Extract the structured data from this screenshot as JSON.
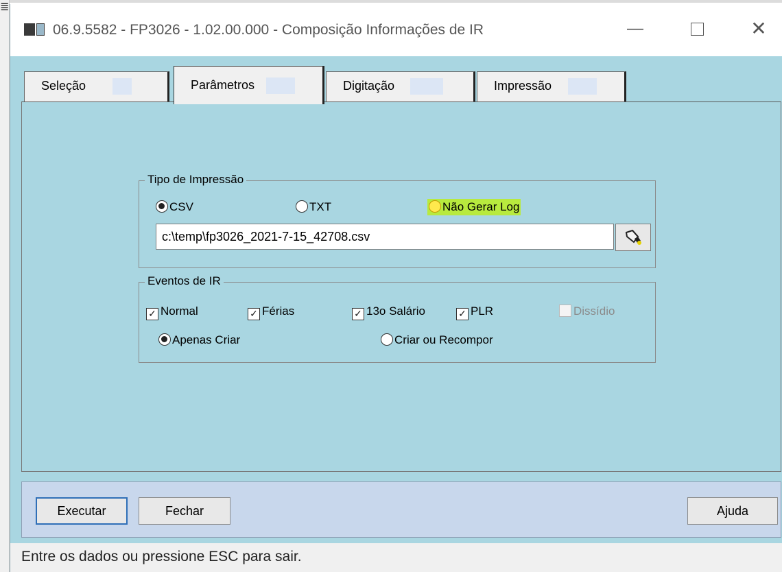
{
  "window": {
    "title": "06.9.5582 - FP3026 - 1.02.00.000 - Composição Informações de IR",
    "minimize_glyph": "—",
    "close_glyph": "✕"
  },
  "tabs": [
    {
      "label": "Seleção",
      "active": false
    },
    {
      "label": "Parâmetros",
      "active": true
    },
    {
      "label": "Digitação",
      "active": false
    },
    {
      "label": "Impressão",
      "active": false
    }
  ],
  "tipo_impressao": {
    "label": "Tipo de Impressão",
    "options": [
      {
        "label": "CSV",
        "selected": true
      },
      {
        "label": "TXT",
        "selected": false
      },
      {
        "label": "Não Gerar Log",
        "selected": false,
        "highlighted": true
      }
    ],
    "file_path": "c:\\temp\\fp3026_2021-7-15_42708.csv",
    "browse_icon": "flashlight-icon"
  },
  "eventos_ir": {
    "label": "Eventos de IR",
    "checkboxes": [
      {
        "label": "Normal",
        "checked": true,
        "enabled": true
      },
      {
        "label": "Férias",
        "checked": true,
        "enabled": true
      },
      {
        "label": "13o Salário",
        "checked": true,
        "enabled": true
      },
      {
        "label": "PLR",
        "checked": true,
        "enabled": true
      },
      {
        "label": "Dissídio",
        "checked": false,
        "enabled": false
      }
    ],
    "modes": [
      {
        "label": "Apenas Criar",
        "selected": true
      },
      {
        "label": "Criar ou Recompor",
        "selected": false
      }
    ]
  },
  "buttons": {
    "executar": "Executar",
    "fechar": "Fechar",
    "ajuda": "Ajuda"
  },
  "status": "Entre os dados ou pressione ESC para sair.",
  "colors": {
    "window_bg": "#a9d6e1",
    "button_bar_bg": "#c8d7ec",
    "highlight": "#b8ea3e"
  }
}
